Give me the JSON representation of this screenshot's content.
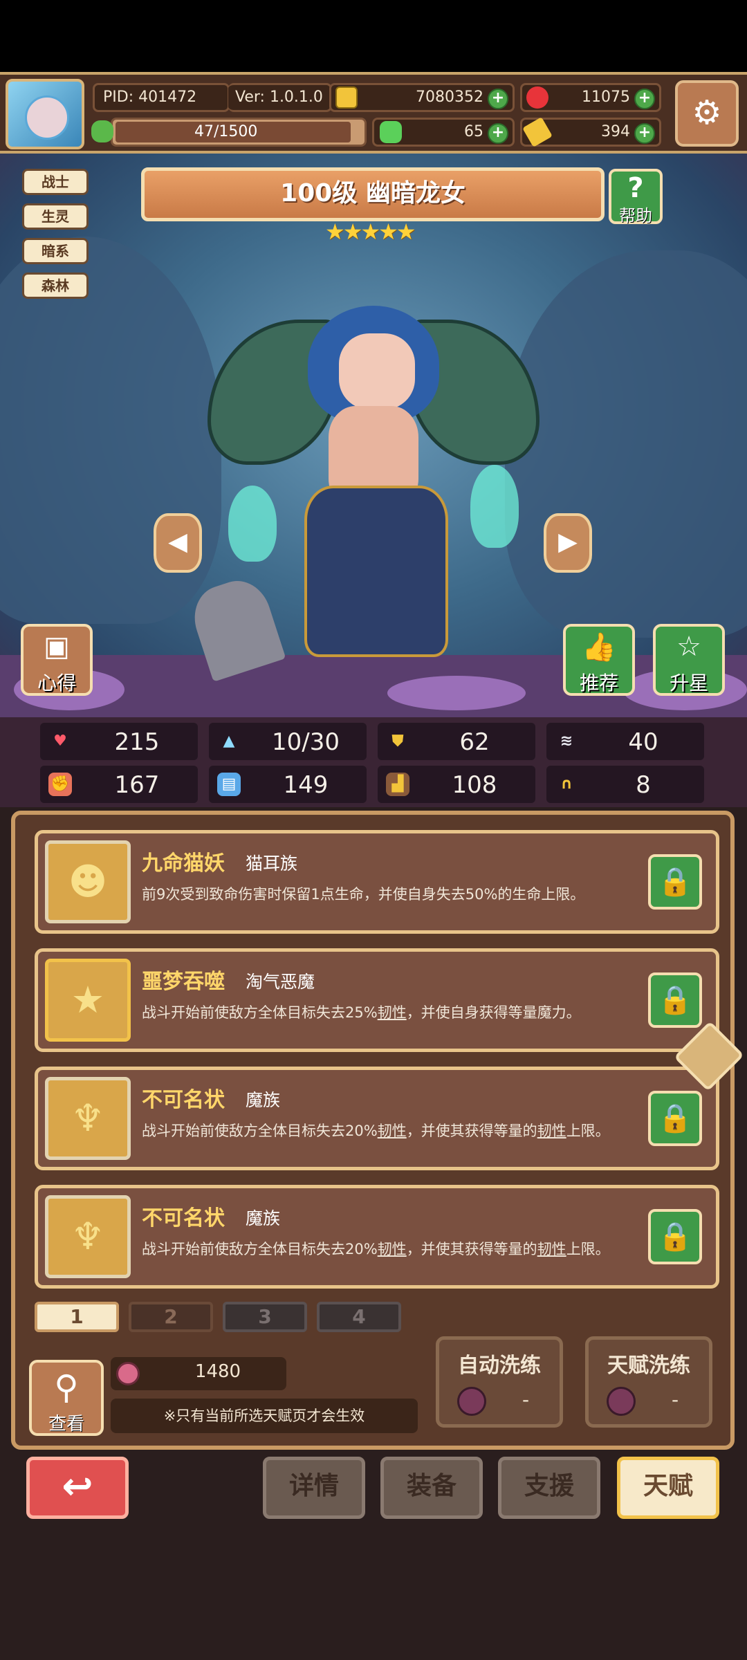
{
  "header": {
    "pid": "PID: 401472",
    "version": "Ver: 1.0.1.0",
    "gold": "7080352",
    "gems": "11075",
    "stamina": "47/1500",
    "clover": "65",
    "ticket": "394"
  },
  "hero": {
    "title": "100级 幽暗龙女",
    "stars": 5,
    "tags": [
      "战士",
      "生灵",
      "暗系",
      "森林"
    ],
    "help_label": "帮助",
    "notes_label": "心得",
    "recommend_label": "推荐",
    "star_up_label": "升星"
  },
  "stats": {
    "hp": "215",
    "mana": "10/30",
    "defense": "62",
    "speed": "40",
    "attack": "167",
    "magic": "149",
    "crit": "108",
    "luck": "8"
  },
  "talents": [
    {
      "name": "九命猫妖",
      "race": "猫耳族",
      "desc_a": "前9次受到致命伤害时保留1点生命，并使自身失去50%的生命上限。",
      "desc_b": "",
      "desc_c": "",
      "desc_d": ""
    },
    {
      "name": "噩梦吞噬",
      "race": "淘气恶魔",
      "desc_a": "战斗开始前使敌方全体目标失去25%",
      "desc_b": "韧性",
      "desc_c": "，并使自身获得等量魔力。",
      "desc_d": ""
    },
    {
      "name": "不可名状",
      "race": "魔族",
      "desc_a": "战斗开始前使敌方全体目标失去20%",
      "desc_b": "韧性",
      "desc_c": "，并使其获得等量的",
      "desc_d": "韧性",
      "desc_e": "上限。"
    },
    {
      "name": "不可名状",
      "race": "魔族",
      "desc_a": "战斗开始前使敌方全体目标失去20%",
      "desc_b": "韧性",
      "desc_c": "，并使其获得等量的",
      "desc_d": "韧性",
      "desc_e": "上限。"
    }
  ],
  "pages": [
    "1",
    "2",
    "3",
    "4"
  ],
  "active_page": "1",
  "footer": {
    "view_label": "查看",
    "fruit_count": "1480",
    "note": "※只有当前所选天赋页才会生效",
    "auto_wash": "自动洗练",
    "auto_wash_cost": "-",
    "talent_wash": "天赋洗练",
    "talent_wash_cost": "-"
  },
  "nav": {
    "details": "详情",
    "equipment": "装备",
    "support": "支援",
    "talent": "天赋"
  },
  "colors": {
    "accent_orange": "#d98a55",
    "green_button": "#3f9a48",
    "gold_text": "#ffd66a",
    "back_red": "#e05050"
  }
}
